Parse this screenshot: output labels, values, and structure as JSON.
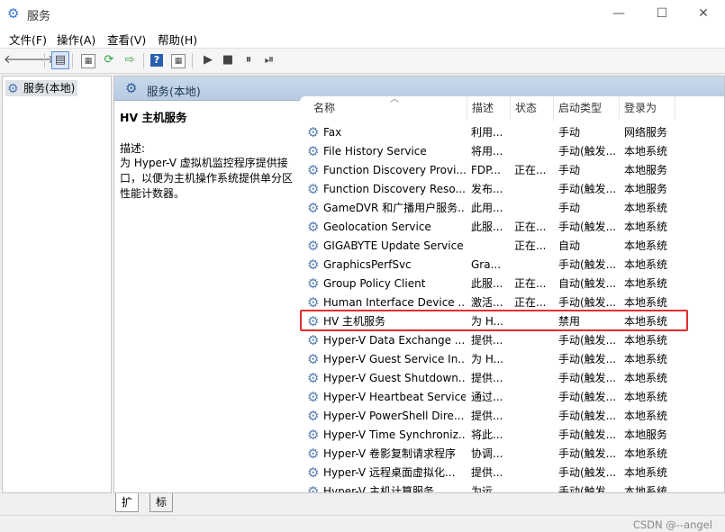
{
  "window": {
    "title": "服务",
    "app_icon": "gear-icon",
    "controls": {
      "minimize": "—",
      "maximize": "☐",
      "close": "✕"
    }
  },
  "menu": [
    "文件(F)",
    "操作(A)",
    "查看(V)",
    "帮助(H)"
  ],
  "toolbar": {
    "back": "🡐",
    "forward": "🡒",
    "console_tree": "▤",
    "properties": "▦",
    "refresh": "⟳",
    "export": "⇨",
    "help": "?",
    "view": "▦",
    "start": "▶",
    "stop": "■",
    "pause": "⏸",
    "restart": "⏯"
  },
  "tree": {
    "root_label": "服务(本地)"
  },
  "pane": {
    "title": "服务(本地)"
  },
  "details": {
    "service_name": "HV 主机服务",
    "desc_label": "描述:",
    "desc_text": "为 Hyper-V 虚拟机监控程序提供接口，以便为主机操作系统提供单分区性能计数器。"
  },
  "list": {
    "columns": {
      "name": "名称",
      "desc": "描述",
      "status": "状态",
      "startup": "启动类型",
      "logon": "登录为"
    },
    "rows": [
      {
        "name": "Fax",
        "desc": "利用...",
        "status": "",
        "startup": "手动",
        "logon": "网络服务"
      },
      {
        "name": "File History Service",
        "desc": "将用...",
        "status": "",
        "startup": "手动(触发...",
        "logon": "本地系统"
      },
      {
        "name": "Function Discovery Provi...",
        "desc": "FDP...",
        "status": "正在...",
        "startup": "手动",
        "logon": "本地服务"
      },
      {
        "name": "Function Discovery Reso...",
        "desc": "发布...",
        "status": "",
        "startup": "手动(触发...",
        "logon": "本地服务"
      },
      {
        "name": "GameDVR 和广播用户服务...",
        "desc": "此用...",
        "status": "",
        "startup": "手动",
        "logon": "本地系统"
      },
      {
        "name": "Geolocation Service",
        "desc": "此服...",
        "status": "正在...",
        "startup": "手动(触发...",
        "logon": "本地系统"
      },
      {
        "name": "GIGABYTE Update Service",
        "desc": "",
        "status": "正在...",
        "startup": "自动",
        "logon": "本地系统"
      },
      {
        "name": "GraphicsPerfSvc",
        "desc": "Gra...",
        "status": "",
        "startup": "手动(触发...",
        "logon": "本地系统"
      },
      {
        "name": "Group Policy Client",
        "desc": "此服...",
        "status": "正在...",
        "startup": "自动(触发...",
        "logon": "本地系统"
      },
      {
        "name": "Human Interface Device ...",
        "desc": "激活...",
        "status": "正在...",
        "startup": "手动(触发...",
        "logon": "本地系统"
      },
      {
        "name": "HV 主机服务",
        "desc": "为 H...",
        "status": "",
        "startup": "禁用",
        "logon": "本地系统"
      },
      {
        "name": "Hyper-V Data Exchange ...",
        "desc": "提供...",
        "status": "",
        "startup": "手动(触发...",
        "logon": "本地系统"
      },
      {
        "name": "Hyper-V Guest Service In...",
        "desc": "为 H...",
        "status": "",
        "startup": "手动(触发...",
        "logon": "本地系统"
      },
      {
        "name": "Hyper-V Guest Shutdown...",
        "desc": "提供...",
        "status": "",
        "startup": "手动(触发...",
        "logon": "本地系统"
      },
      {
        "name": "Hyper-V Heartbeat Service",
        "desc": "通过...",
        "status": "",
        "startup": "手动(触发...",
        "logon": "本地系统"
      },
      {
        "name": "Hyper-V PowerShell Dire...",
        "desc": "提供...",
        "status": "",
        "startup": "手动(触发...",
        "logon": "本地系统"
      },
      {
        "name": "Hyper-V Time Synchroniz...",
        "desc": "将此...",
        "status": "",
        "startup": "手动(触发...",
        "logon": "本地服务"
      },
      {
        "name": "Hyper-V 卷影复制请求程序",
        "desc": "协调...",
        "status": "",
        "startup": "手动(触发...",
        "logon": "本地系统"
      },
      {
        "name": "Hyper-V 远程桌面虚拟化...",
        "desc": "提供...",
        "status": "",
        "startup": "手动(触发...",
        "logon": "本地系统"
      },
      {
        "name": "Hyper-V 主机计算服务",
        "desc": "为运...",
        "status": "",
        "startup": "手动(触发...",
        "logon": "本地系统"
      }
    ]
  },
  "tabs": [
    "扩展",
    "标准"
  ],
  "watermark": "CSDN @--angel",
  "colors": {
    "highlight_border": "#e42c2c",
    "header_blue": "#c4d4e8"
  }
}
